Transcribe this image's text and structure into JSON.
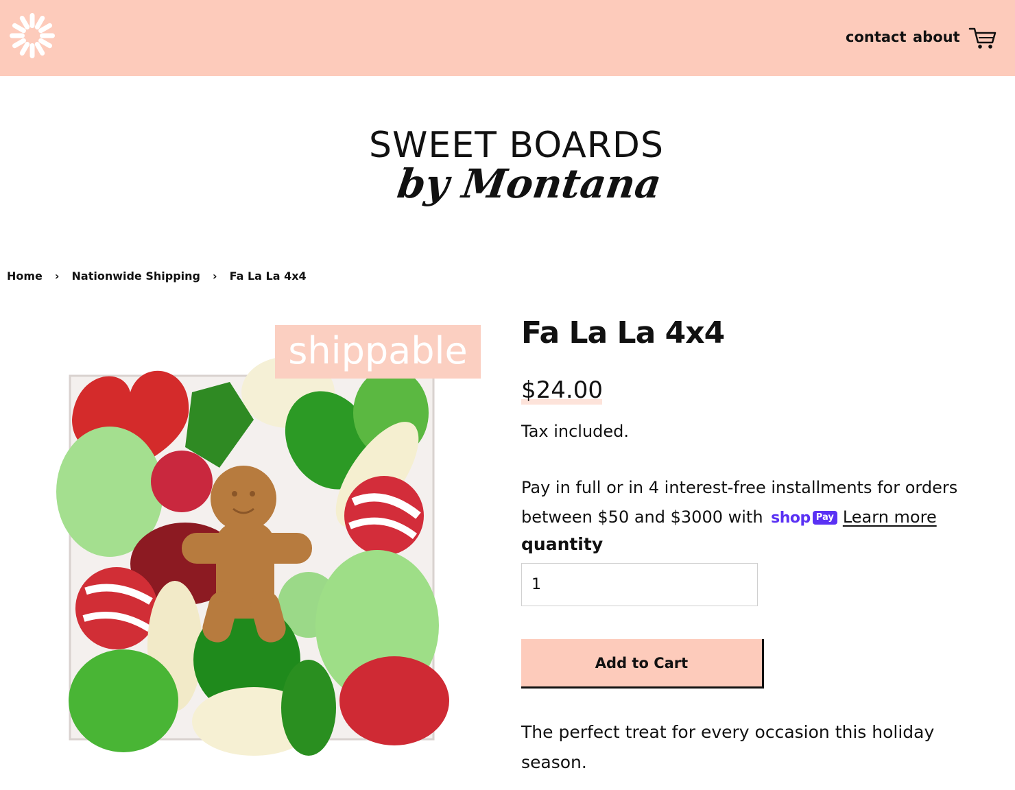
{
  "header": {
    "background": "#fdcbbb",
    "logo_icon": "starburst-icon",
    "nav": [
      {
        "label": "contact"
      },
      {
        "label": "about"
      }
    ],
    "cart_icon": "cart-icon"
  },
  "brand": {
    "line1": "SWEET BOARDS",
    "line2": "by Montana"
  },
  "breadcrumb": {
    "items": [
      "Home",
      "Nationwide Shipping",
      "Fa La La 4x4"
    ],
    "separator": "›"
  },
  "product": {
    "image_badge": "shippable",
    "title": "Fa La La 4x4",
    "price": "$24.00",
    "tax_note": "Tax included.",
    "installments_text": "Pay in full or in 4 interest-free installments for orders between $50 and $3000 with",
    "shop_pay_word": "shop",
    "shop_pay_badge": "Pay",
    "learn_more": "Learn more",
    "quantity_label": "quantity",
    "quantity_value": "1",
    "add_to_cart": "Add to Cart",
    "description": "The perfect treat for every occasion this holiday season."
  },
  "colors": {
    "accent": "#fdcbbb",
    "shop_pay": "#5a31f4",
    "text": "#111111"
  }
}
